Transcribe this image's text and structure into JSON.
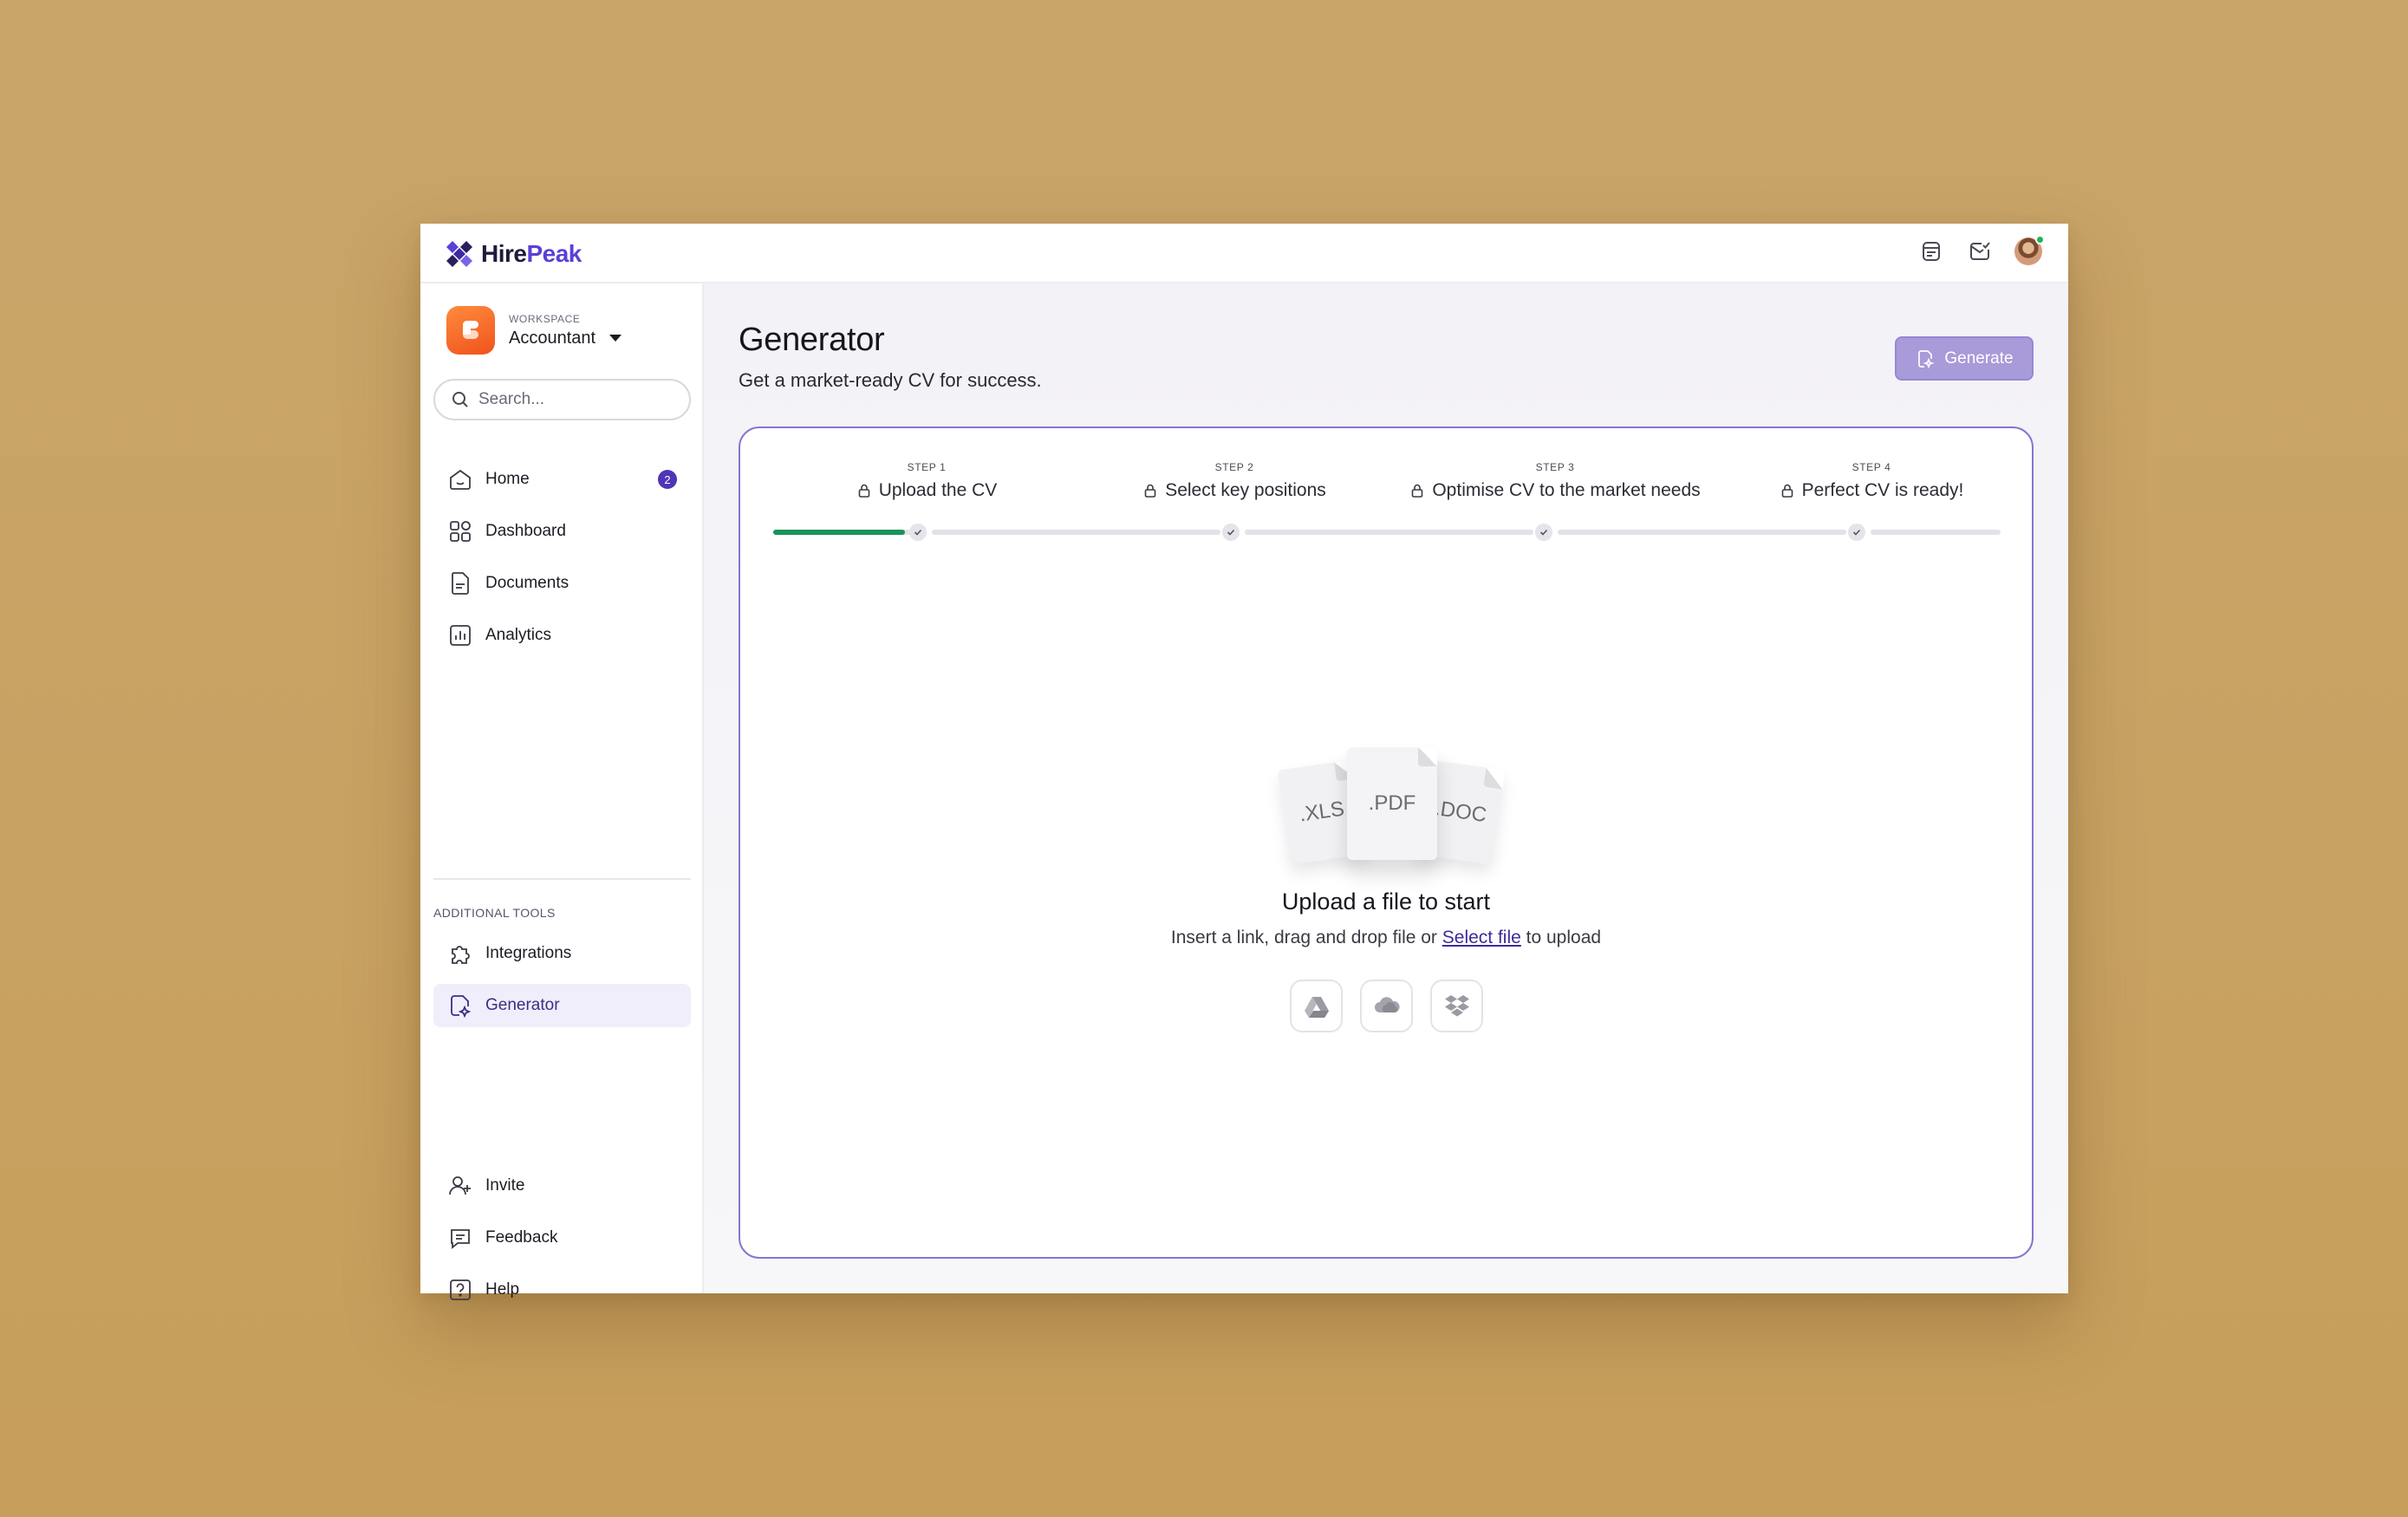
{
  "app": {
    "brand_part1": "Hire",
    "brand_part2": "Peak"
  },
  "workspace": {
    "label": "WORKSPACE",
    "name": "Accountant"
  },
  "search": {
    "placeholder": "Search..."
  },
  "nav": {
    "home": {
      "label": "Home",
      "badge": "2"
    },
    "dashboard": {
      "label": "Dashboard"
    },
    "documents": {
      "label": "Documents"
    },
    "analytics": {
      "label": "Analytics"
    },
    "section_label": "ADDITIONAL TOOLS",
    "integrations": {
      "label": "Integrations"
    },
    "generator": {
      "label": "Generator"
    },
    "invite": {
      "label": "Invite"
    },
    "feedback": {
      "label": "Feedback"
    },
    "help": {
      "label": "Help"
    }
  },
  "page": {
    "title": "Generator",
    "subtitle": "Get a market-ready CV for success.",
    "generate_label": "Generate"
  },
  "steps": [
    {
      "num": "STEP 1",
      "title": "Upload the CV"
    },
    {
      "num": "STEP 2",
      "title": "Select key positions"
    },
    {
      "num": "STEP 3",
      "title": "Optimise CV to the market needs"
    },
    {
      "num": "STEP 4",
      "title": "Perfect CV is ready!"
    }
  ],
  "progress": {
    "step1_fill_fraction": 0.92
  },
  "upload": {
    "file_left": ".XLS",
    "file_mid": ".PDF",
    "file_right": ".DOC",
    "title": "Upload a file to start",
    "text_before": "Insert a link, drag and drop file or ",
    "link": "Select file",
    "text_after": " to upload",
    "providers": [
      "google-drive-icon",
      "onedrive-icon",
      "dropbox-icon"
    ]
  },
  "colors": {
    "accent": "#5b3fd6",
    "progress": "#19945a",
    "generate_button": "#a99ad9",
    "workspace_logo": "#f0531c"
  }
}
